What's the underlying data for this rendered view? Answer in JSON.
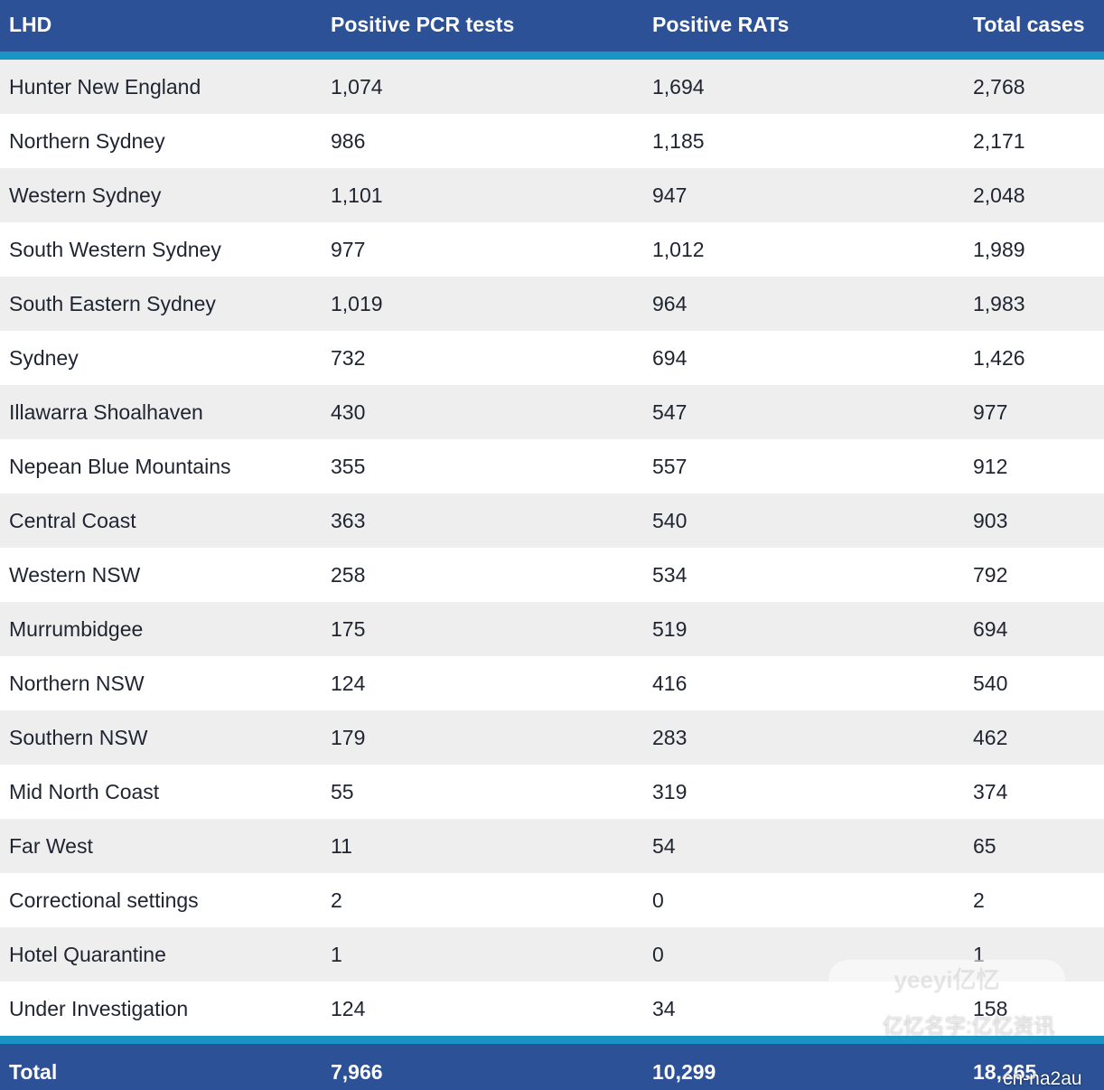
{
  "table": {
    "headers": [
      "LHD",
      "Positive PCR tests",
      "Positive RATs",
      "Total cases"
    ],
    "rows": [
      [
        "Hunter New England",
        "1,074",
        "1,694",
        "2,768"
      ],
      [
        "Northern Sydney",
        "986",
        "1,185",
        "2,171"
      ],
      [
        "Western Sydney",
        "1,101",
        "947",
        "2,048"
      ],
      [
        "South Western Sydney",
        "977",
        "1,012",
        "1,989"
      ],
      [
        "South Eastern Sydney",
        "1,019",
        "964",
        "1,983"
      ],
      [
        "Sydney",
        "732",
        "694",
        "1,426"
      ],
      [
        "Illawarra Shoalhaven",
        "430",
        "547",
        "977"
      ],
      [
        "Nepean Blue Mountains",
        "355",
        "557",
        "912"
      ],
      [
        "Central Coast",
        "363",
        "540",
        "903"
      ],
      [
        "Western NSW",
        "258",
        "534",
        "792"
      ],
      [
        "Murrumbidgee",
        "175",
        "519",
        "694"
      ],
      [
        "Northern NSW",
        "124",
        "416",
        "540"
      ],
      [
        "Southern NSW",
        "179",
        "283",
        "462"
      ],
      [
        "Mid North Coast",
        "55",
        "319",
        "374"
      ],
      [
        "Far West",
        "11",
        "54",
        "65"
      ],
      [
        "Correctional settings",
        "2",
        "0",
        "2"
      ],
      [
        "Hotel Quarantine",
        "1",
        "0",
        "1"
      ],
      [
        "Under Investigation",
        "124",
        "34",
        "158"
      ]
    ],
    "total": [
      "Total",
      "7,966",
      "10,299",
      "18,265"
    ]
  },
  "watermarks": {
    "pill_text": "yeeyi亿忆",
    "site_text": "亿忆名字:亿忆资讯",
    "tag_text": "cn-na2au"
  },
  "colors": {
    "header_bg": "#2c5196",
    "accent_rule": "#1a93c5",
    "stripe_bg": "#eeeeee"
  }
}
